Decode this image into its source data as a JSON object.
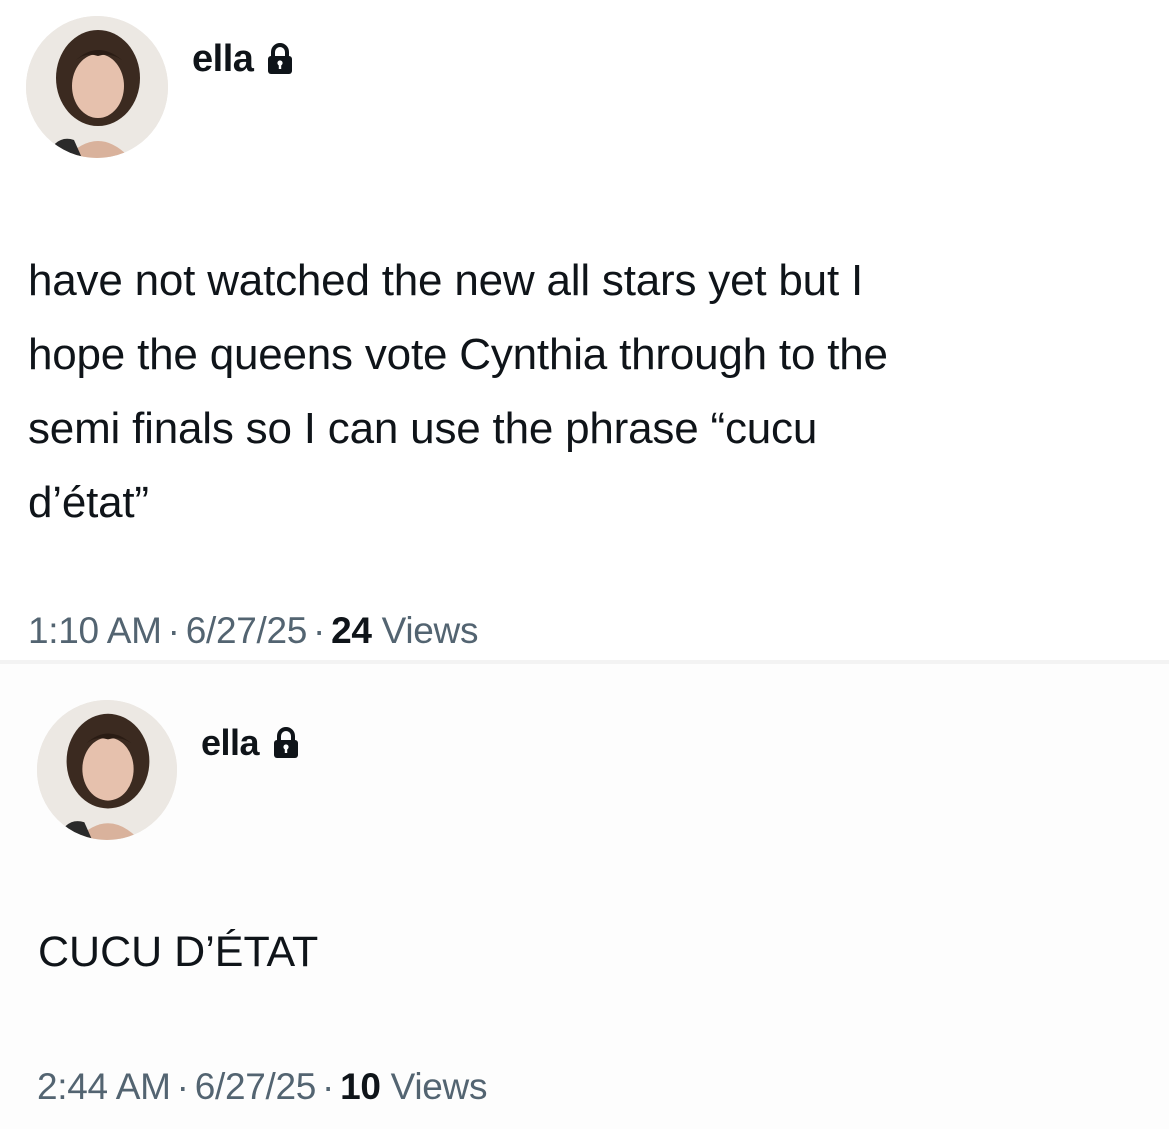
{
  "posts": [
    {
      "username": "ella",
      "lock_icon": "lock-icon",
      "text": "have not watched the new all stars yet but I\nhope the queens vote Cynthia through to the\nsemi finals so I can use the phrase “cucu\nd’état”",
      "time": "1:10 AM",
      "date": "6/27/25",
      "views_count": "24",
      "views_label": "Views",
      "separator": "·"
    },
    {
      "username": "ella",
      "lock_icon": "lock-icon",
      "text": "CUCU D’ÉTAT",
      "time": "2:44 AM",
      "date": "6/27/25",
      "views_count": "10",
      "views_label": "Views",
      "separator": "·"
    }
  ],
  "colors": {
    "text_primary": "#0f1419",
    "text_secondary": "#536471",
    "background": "#ffffff"
  }
}
